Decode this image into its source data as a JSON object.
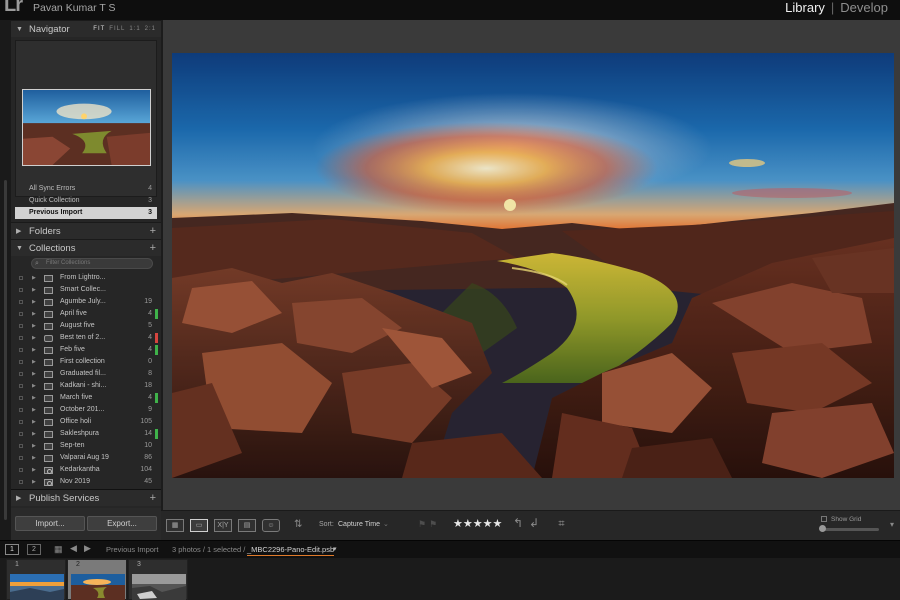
{
  "app": {
    "logo": "Lr",
    "user": "Pavan Kumar T S",
    "modules": [
      {
        "label": "Library",
        "active": true
      },
      {
        "label": "Develop",
        "active": false
      }
    ],
    "module_sep": "|"
  },
  "navigator": {
    "title": "Navigator",
    "zoom_options": [
      "FIT",
      "FILL",
      "1:1",
      "2:1"
    ]
  },
  "catalog": {
    "items": [
      {
        "label": "All Sync Errors",
        "count": "4"
      },
      {
        "label": "Quick Collection",
        "count": "3"
      },
      {
        "label": "Previous Import",
        "count": "3",
        "selected": true
      }
    ]
  },
  "folders": {
    "title": "Folders"
  },
  "collections": {
    "title": "Collections",
    "filter_placeholder": "Filter Collections",
    "items": [
      {
        "label": "From Lightro...",
        "count": "",
        "type": "set",
        "label_color": ""
      },
      {
        "label": "Smart Collec...",
        "count": "",
        "type": "set",
        "label_color": ""
      },
      {
        "label": "Agumbe July...",
        "count": "19",
        "type": "coll",
        "label_color": ""
      },
      {
        "label": "April five",
        "count": "4",
        "type": "coll",
        "label_color": "#3fb24a"
      },
      {
        "label": "August five",
        "count": "5",
        "type": "coll",
        "label_color": ""
      },
      {
        "label": "Best ten of 2...",
        "count": "4",
        "type": "shared",
        "label_color": "#d6453f"
      },
      {
        "label": "Feb five",
        "count": "4",
        "type": "coll",
        "label_color": "#3fb24a"
      },
      {
        "label": "First collection",
        "count": "0",
        "type": "coll",
        "label_color": ""
      },
      {
        "label": "Graduated fil...",
        "count": "8",
        "type": "coll",
        "label_color": ""
      },
      {
        "label": "Kadkani - shi...",
        "count": "18",
        "type": "coll",
        "label_color": ""
      },
      {
        "label": "March five",
        "count": "4",
        "type": "coll",
        "label_color": "#3fb24a"
      },
      {
        "label": "October 201...",
        "count": "9",
        "type": "coll",
        "label_color": ""
      },
      {
        "label": "Office holi",
        "count": "105",
        "type": "coll",
        "label_color": ""
      },
      {
        "label": "Sakleshpura",
        "count": "14",
        "type": "coll",
        "label_color": "#3fb24a"
      },
      {
        "label": "Sep-ten",
        "count": "10",
        "type": "coll",
        "label_color": ""
      },
      {
        "label": "Valparai Aug 19",
        "count": "86",
        "type": "coll",
        "label_color": ""
      },
      {
        "label": "Kedarkantha",
        "count": "104",
        "type": "smart",
        "label_color": ""
      },
      {
        "label": "Nov 2019",
        "count": "45",
        "type": "smart",
        "label_color": ""
      }
    ]
  },
  "publish": {
    "title": "Publish Services"
  },
  "buttons": {
    "import": "Import...",
    "export": "Export..."
  },
  "toolbar": {
    "view_icons": [
      "grid-view",
      "loupe-view",
      "compare-view",
      "survey-view",
      "people-view"
    ],
    "compare_text": "X|Y",
    "sort_label": "Sort:",
    "sort_value": "Capture Time",
    "rating_stars": "★★★★★",
    "rating": 5,
    "show_grid": "Show Grid"
  },
  "filmstrip_bar": {
    "screen1": "1",
    "screen2": "2",
    "source": "Previous Import",
    "count": "3 photos / 1 selected /",
    "file": "_MBC2296-Pano-Edit.psb"
  },
  "filmstrip": [
    {
      "num": "1",
      "selected": false
    },
    {
      "num": "2",
      "selected": true
    },
    {
      "num": "3",
      "selected": false
    }
  ],
  "colors": {
    "accent": "#e07a2a",
    "label_green": "#3fb24a",
    "label_red": "#d6453f",
    "selected_row": "#d2d2d2"
  }
}
